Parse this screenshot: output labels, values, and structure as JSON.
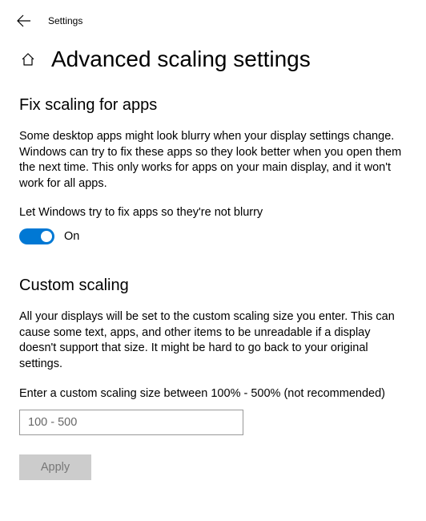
{
  "header": {
    "app_name": "Settings"
  },
  "page": {
    "title": "Advanced scaling settings"
  },
  "fix_scaling": {
    "heading": "Fix scaling for apps",
    "description": "Some desktop apps might look blurry when your display settings change. Windows can try to fix these apps so they look better when you open them the next time. This only works for apps on your main display, and it won't work for all apps.",
    "toggle_label": "Let Windows try to fix apps so they're not blurry",
    "toggle_state": "On"
  },
  "custom_scaling": {
    "heading": "Custom scaling",
    "description": "All your displays will be set to the custom scaling size you enter. This can cause some text, apps, and other items to be unreadable if a display doesn't support that size. It might be hard to go back to your original settings.",
    "field_label": "Enter a custom scaling size between 100% - 500% (not recommended)",
    "placeholder": "100 - 500",
    "apply_label": "Apply"
  }
}
